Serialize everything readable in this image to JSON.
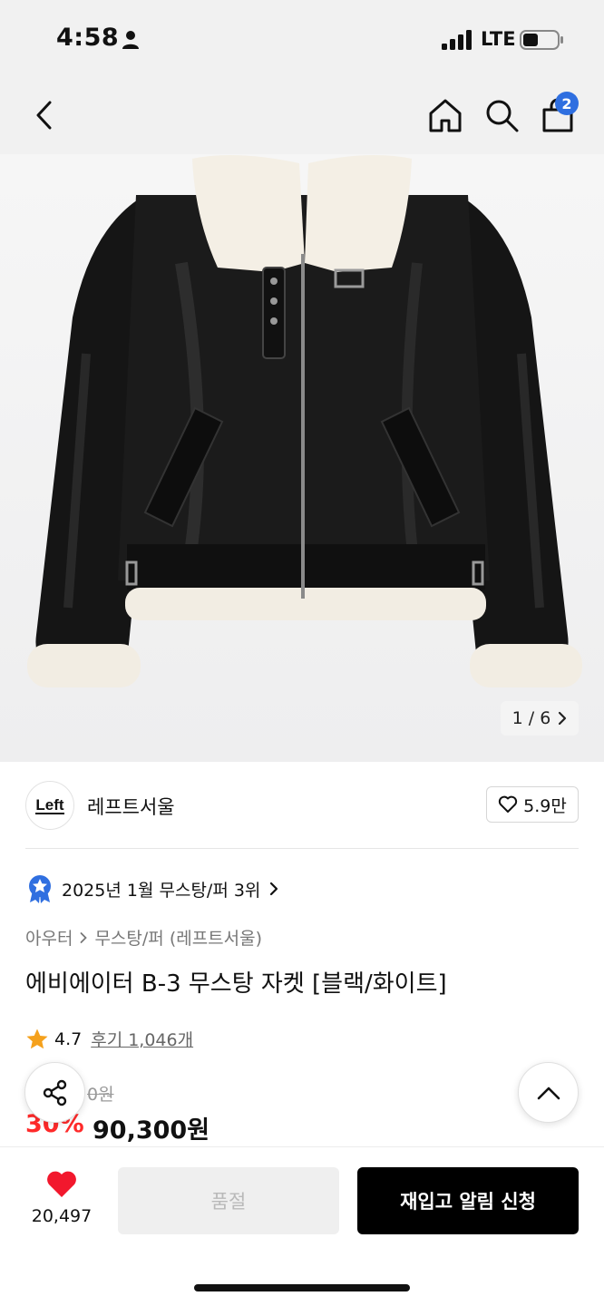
{
  "status_bar": {
    "time": "4:58",
    "network": "LTE"
  },
  "nav": {
    "cart_badge": "2"
  },
  "image": {
    "counter": "1 / 6"
  },
  "brand": {
    "logo_text": "Left",
    "name": "레프트서울",
    "likes": "5.9만"
  },
  "ranking": {
    "text": "2025년 1월 무스탕/퍼 3위"
  },
  "breadcrumb": {
    "category": "아우터",
    "subcategory": "무스탕/퍼 (레프트서울)"
  },
  "product": {
    "title": "에비에이터 B-3 무스탕 자켓 [블랙/화이트]"
  },
  "rating": {
    "score": "4.7",
    "reviews": "후기 1,046개"
  },
  "price": {
    "original": "0원",
    "discount": "30%",
    "sale": "90,300원"
  },
  "bottom": {
    "wish_count": "20,497",
    "soldout_label": "품절",
    "restock_label": "재입고 알림 신청"
  },
  "colors": {
    "discount": "#ff2a2a",
    "heart": "#f2182d",
    "badge": "#2f6fe0"
  }
}
